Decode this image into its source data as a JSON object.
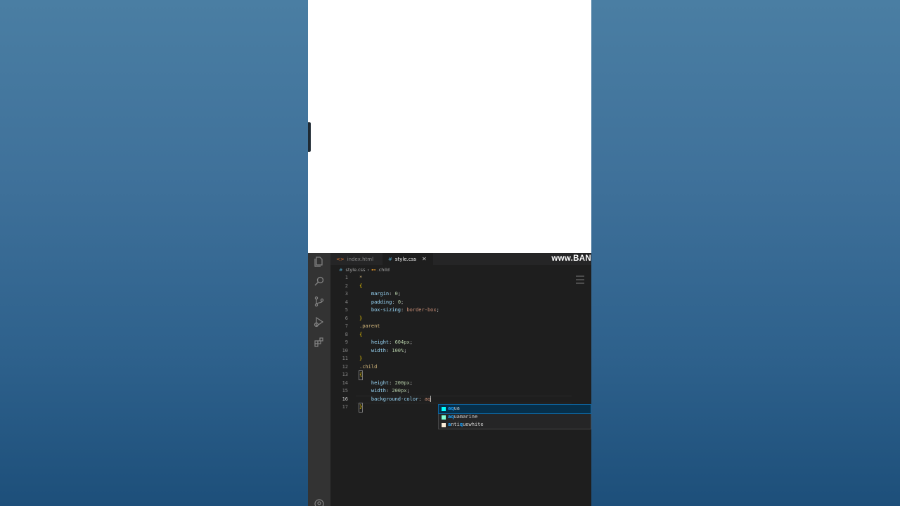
{
  "watermark": "www.BAN",
  "tabs": [
    {
      "label": "index.html",
      "icon": "html-file-icon",
      "active": false
    },
    {
      "label": "style.css",
      "icon": "css-file-icon",
      "active": true,
      "close": "✕"
    }
  ],
  "breadcrumb": {
    "file": "style.css",
    "symbol": ".child"
  },
  "code_lines": [
    {
      "n": "1",
      "text": "*"
    },
    {
      "n": "2",
      "text": "{"
    },
    {
      "n": "3",
      "text": "    margin: 0;"
    },
    {
      "n": "4",
      "text": "    padding: 0;"
    },
    {
      "n": "5",
      "text": "    box-sizing: border-box;"
    },
    {
      "n": "6",
      "text": "}"
    },
    {
      "n": "7",
      "text": ".parent"
    },
    {
      "n": "8",
      "text": "{"
    },
    {
      "n": "9",
      "text": "    height: 604px;"
    },
    {
      "n": "10",
      "text": "    width: 100%;"
    },
    {
      "n": "11",
      "text": "}"
    },
    {
      "n": "12",
      "text": ".child"
    },
    {
      "n": "13",
      "text": "{"
    },
    {
      "n": "14",
      "text": "    height: 200px;"
    },
    {
      "n": "15",
      "text": "    width: 200px;"
    },
    {
      "n": "16",
      "text": "    background-color: aq"
    },
    {
      "n": "17",
      "text": "}"
    }
  ],
  "current_line": "16",
  "suggestions": [
    {
      "match": "aq",
      "rest": "ua",
      "full": "aqua",
      "color": "#00ffff",
      "selected": true
    },
    {
      "match": "aq",
      "rest": "uamarine",
      "full": "aquamarine",
      "color": "#7fffd4",
      "selected": false
    },
    {
      "match": "a",
      "mid": "nti",
      "q": "q",
      "rest": "uewhite",
      "full": "antiquewhite",
      "color": "#faebd7",
      "selected": false
    }
  ],
  "activity_icons": [
    "explorer-icon",
    "search-icon",
    "source-control-icon",
    "run-debug-icon",
    "extensions-icon",
    "account-icon"
  ]
}
